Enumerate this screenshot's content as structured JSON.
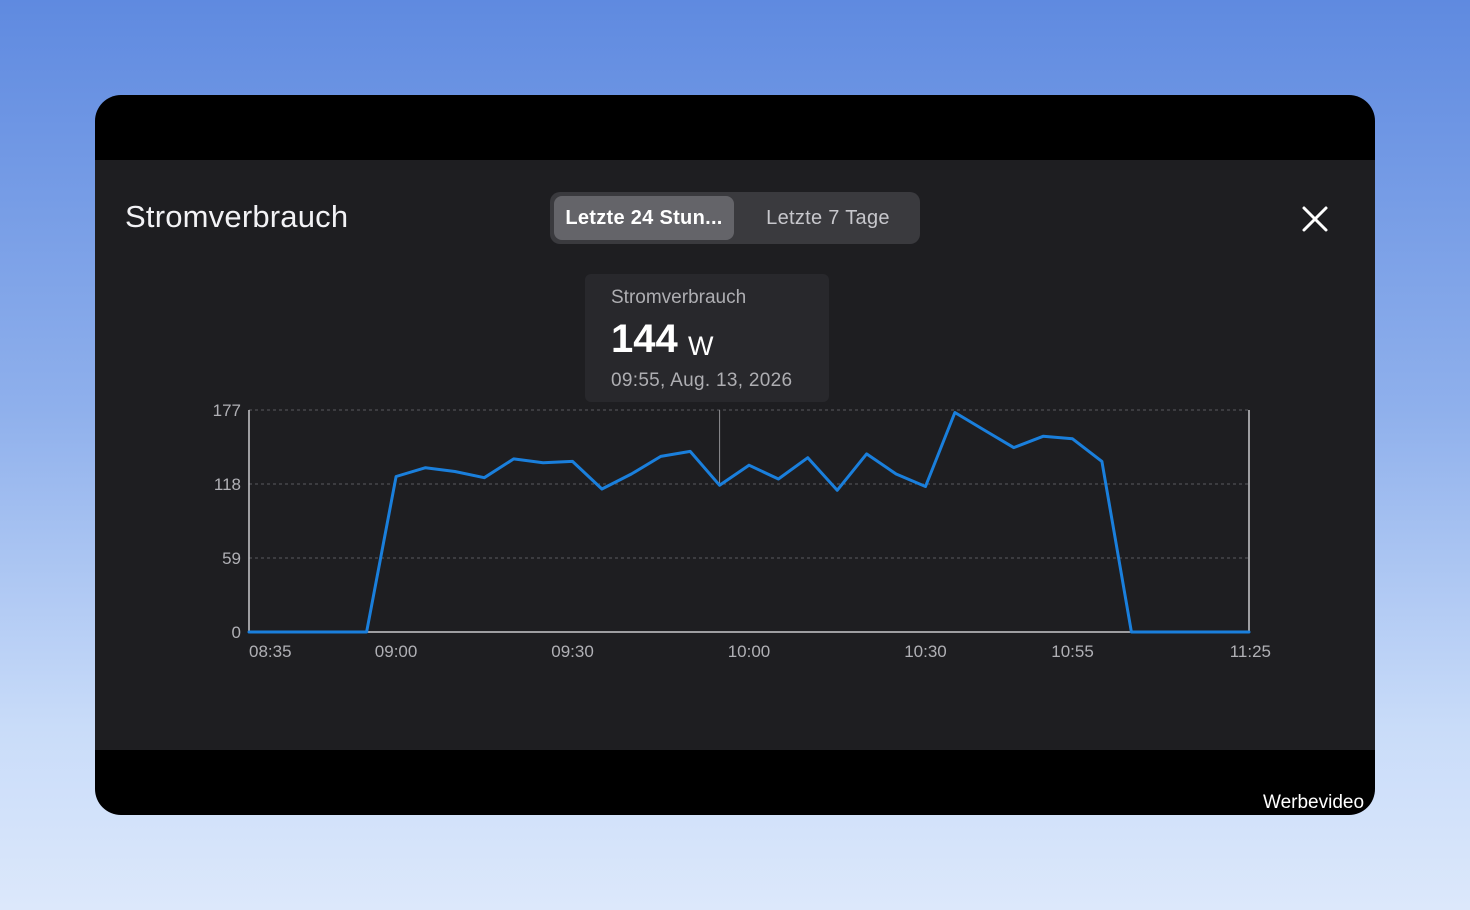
{
  "dialog": {
    "title": "Stromverbrauch",
    "close_icon": "close-icon"
  },
  "segmented": {
    "options": [
      {
        "label": "Letzte 24 Stun...",
        "selected": true
      },
      {
        "label": "Letzte 7 Tage",
        "selected": false
      }
    ]
  },
  "tooltip": {
    "label": "Stromverbrauch",
    "value": "144",
    "unit": "W",
    "timestamp": "09:55, Aug. 13, 2026"
  },
  "watermark": "Werbevideo",
  "colors": {
    "line": "#1a7fdc",
    "panel": "#1e1e21",
    "grid": "#5a5a5e"
  },
  "chart_data": {
    "type": "line",
    "series": [
      {
        "x": [
          "08:35",
          "08:40",
          "08:45",
          "08:50",
          "08:55",
          "09:00",
          "09:05",
          "09:10",
          "09:15",
          "09:20",
          "09:25",
          "09:30",
          "09:35",
          "09:40",
          "09:45",
          "09:50",
          "09:55",
          "10:00",
          "10:05",
          "10:10",
          "10:15",
          "10:20",
          "10:25",
          "10:30",
          "10:35",
          "10:40",
          "10:45",
          "10:50",
          "10:55",
          "11:00",
          "11:05",
          "11:10",
          "11:15",
          "11:20",
          "11:25"
        ],
        "values": [
          0,
          0,
          0,
          0,
          0,
          124,
          131,
          128,
          123,
          138,
          135,
          136,
          114,
          126,
          140,
          144,
          117,
          133,
          122,
          139,
          113,
          142,
          126,
          116,
          175,
          161,
          147,
          156,
          154,
          136,
          0,
          0,
          0,
          0,
          0
        ]
      }
    ],
    "x_tick_labels": [
      "08:35",
      "09:00",
      "09:30",
      "10:00",
      "10:30",
      "10:55",
      "11:25"
    ],
    "y_tick_labels": [
      0,
      59,
      118,
      177
    ],
    "ylim": [
      0,
      177
    ],
    "grid": true,
    "cursor_x": "09:55"
  }
}
